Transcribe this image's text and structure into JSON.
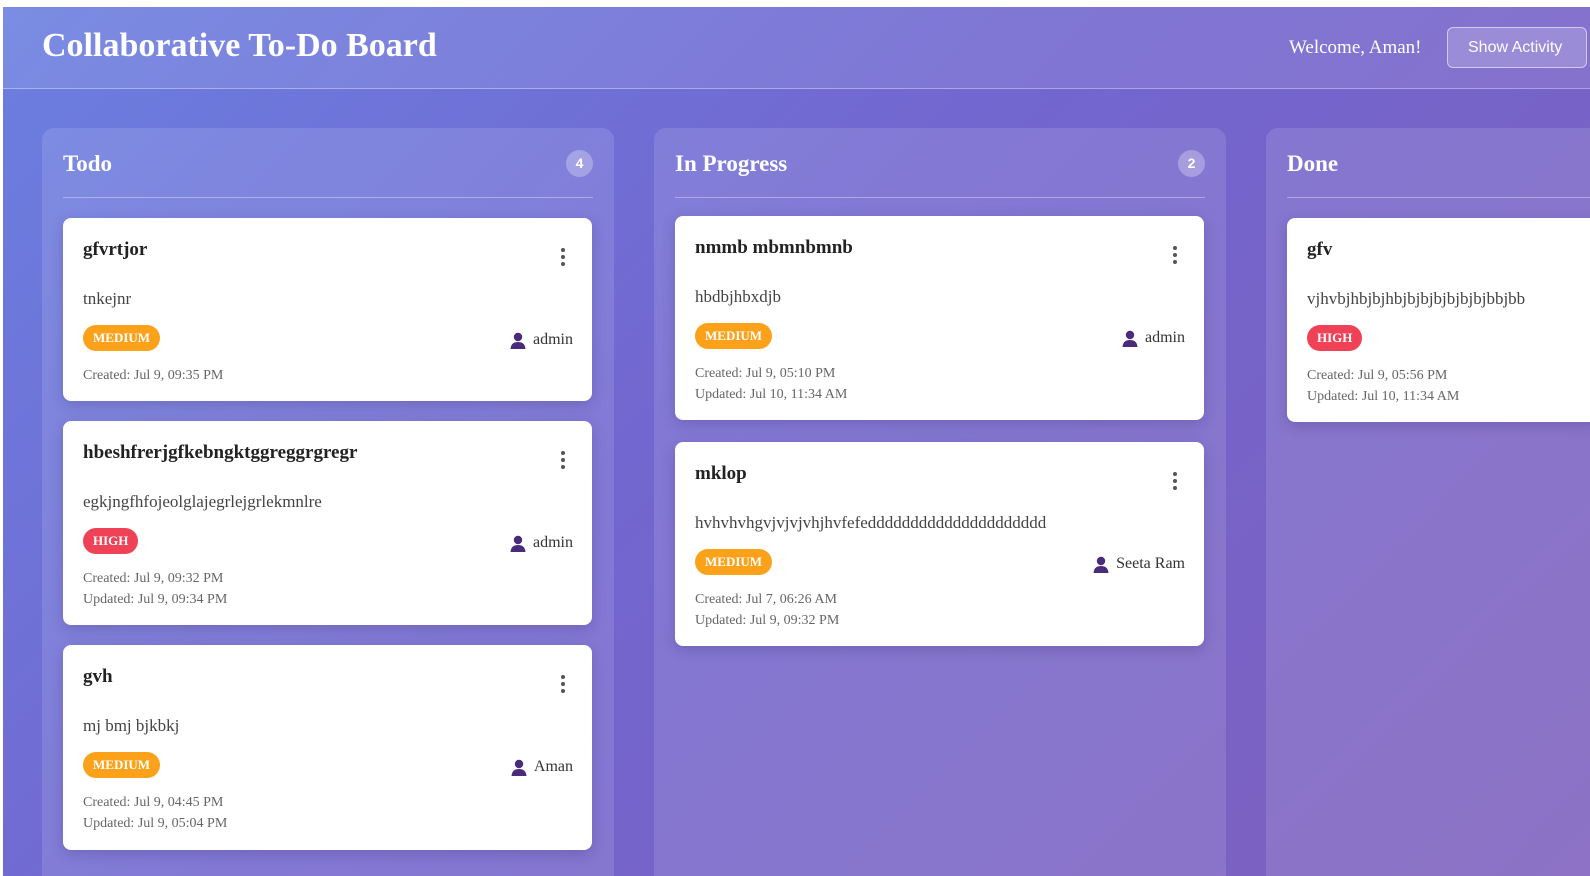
{
  "header": {
    "title": "Collaborative To-Do Board",
    "welcome": "Welcome, Aman!",
    "activity_button": "Show Activity"
  },
  "columns": [
    {
      "title": "Todo",
      "count": "4",
      "cards": [
        {
          "title": "gfvrtjor",
          "description": "tnkejnr",
          "priority": "MEDIUM",
          "assignee": "admin",
          "created": "Created: Jul 9, 09:35 PM",
          "updated": ""
        },
        {
          "title": "hbeshfrerjgfkebngktggreggrgregr",
          "description": "egkjngfhfojeolglajegrlejgrlekmnlre",
          "priority": "HIGH",
          "assignee": "admin",
          "created": "Created: Jul 9, 09:32 PM",
          "updated": "Updated: Jul 9, 09:34 PM"
        },
        {
          "title": "gvh",
          "description": "mj bmj bjkbkj",
          "priority": "MEDIUM",
          "assignee": "Aman",
          "created": "Created: Jul 9, 04:45 PM",
          "updated": "Updated: Jul 9, 05:04 PM"
        }
      ]
    },
    {
      "title": "In Progress",
      "count": "2",
      "cards": [
        {
          "title": "nmmb mbmnbmnb",
          "description": "hbdbjhbxdjb",
          "priority": "MEDIUM",
          "assignee": "admin",
          "created": "Created: Jul 9, 05:10 PM",
          "updated": "Updated: Jul 10, 11:34 AM"
        },
        {
          "title": "mklop",
          "description": "hvhvhvhgvjvjvjvhjhvfefeddddddddddddddddddddd",
          "priority": "MEDIUM",
          "assignee": "Seeta Ram",
          "created": "Created: Jul 7, 06:26 AM",
          "updated": "Updated: Jul 9, 09:32 PM"
        }
      ]
    },
    {
      "title": "Done",
      "count": "",
      "cards": [
        {
          "title": "gfv",
          "description": "vjhvbjhbjbjhbjbjbjbjbjbjbjbbjbb",
          "priority": "HIGH",
          "assignee": "",
          "created": "Created: Jul 9, 05:56 PM",
          "updated": "Updated: Jul 10, 11:34 AM"
        }
      ]
    }
  ],
  "colors": {
    "priority_medium": "#fba21a",
    "priority_high": "#f04257",
    "person_icon": "#4a2a7a"
  },
  "icons": {
    "menu": "kebab-menu-icon",
    "assignee": "person-icon"
  }
}
